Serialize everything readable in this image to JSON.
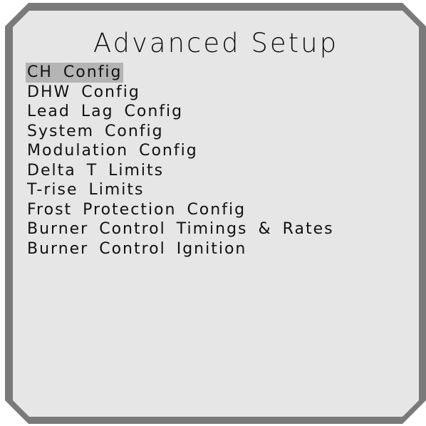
{
  "screen": {
    "title": "Advanced Setup"
  },
  "menu": {
    "selected_index": 0,
    "items": [
      {
        "label": "CH Config"
      },
      {
        "label": "DHW Config"
      },
      {
        "label": "Lead Lag Config"
      },
      {
        "label": "System Config"
      },
      {
        "label": "Modulation Config"
      },
      {
        "label": "Delta T Limits"
      },
      {
        "label": "T-rise Limits"
      },
      {
        "label": "Frost Protection Config"
      },
      {
        "label": "Burner Control Timings & Rates"
      },
      {
        "label": "Burner Control Ignition"
      }
    ]
  },
  "colors": {
    "bezel": "#7a7a7a",
    "screen_background": "#e6e6e6",
    "selection_highlight": "#b4b4b4",
    "text": "#111111"
  }
}
